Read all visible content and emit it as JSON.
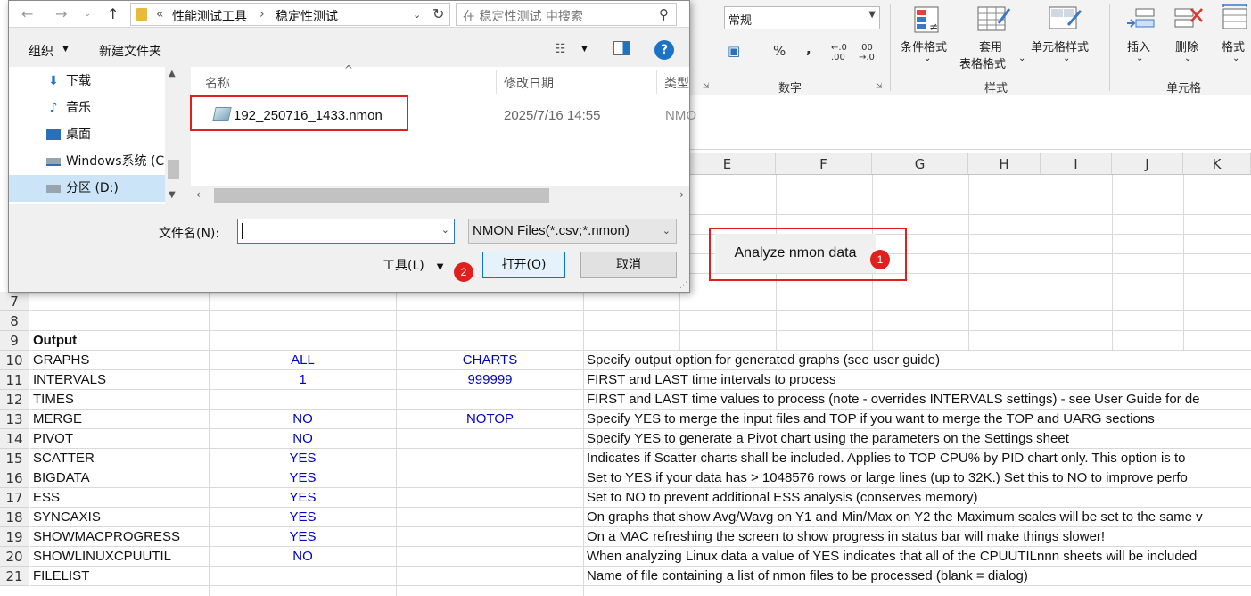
{
  "ribbon": {
    "number_format": "常规",
    "group_number": "数字",
    "group_styles": "样式",
    "group_cells": "单元格",
    "btn_conditional": "条件格式",
    "btn_table_line1": "套用",
    "btn_table_line2": "表格格式",
    "btn_cellstyle": "单元格样式",
    "btn_insert": "插入",
    "btn_delete": "删除",
    "btn_format": "格式",
    "percent": "%",
    "comma": ","
  },
  "dialog": {
    "path": [
      "性能测试工具",
      "稳定性测试"
    ],
    "search_placeholder": "在 稳定性测试 中搜索",
    "organize": "组织",
    "new_folder": "新建文件夹",
    "nav_items": [
      {
        "label": "下载",
        "icon": "download-icon"
      },
      {
        "label": "音乐",
        "icon": "music-icon"
      },
      {
        "label": "桌面",
        "icon": "desktop-icon"
      },
      {
        "label": "Windows系统 (C",
        "icon": "drive-icon"
      },
      {
        "label": "分区 (D:)",
        "icon": "drive-icon"
      }
    ],
    "columns": {
      "name": "名称",
      "date": "修改日期",
      "type": "类型"
    },
    "file": {
      "name": "192_250716_1433.nmon",
      "date": "2025/7/16 14:55",
      "type": "NMO"
    },
    "filename_label": "文件名(N):",
    "filename_value": "",
    "filter": "NMON Files(*.csv;*.nmon)",
    "tools": "工具(L)",
    "open": "打开(O)",
    "cancel": "取消"
  },
  "sheet": {
    "columns": [
      "E",
      "F",
      "G",
      "H",
      "I",
      "J",
      "K"
    ],
    "analyze_button": "Analyze nmon data",
    "badge1": "1",
    "badge2": "2",
    "rows": [
      {
        "n": "7",
        "a": "",
        "b": "",
        "c": "",
        "d": ""
      },
      {
        "n": "8",
        "a": "",
        "b": "",
        "c": "",
        "d": ""
      },
      {
        "n": "9",
        "a": "Output",
        "b": "",
        "c": "",
        "d": ""
      },
      {
        "n": "10",
        "a": "GRAPHS",
        "b": "ALL",
        "c": "CHARTS",
        "d": "Specify output option for generated graphs (see user guide)"
      },
      {
        "n": "11",
        "a": "INTERVALS",
        "b": "1",
        "c": "999999",
        "d": "FIRST and LAST time intervals to process"
      },
      {
        "n": "12",
        "a": "TIMES",
        "b": "",
        "c": "",
        "d": "FIRST and LAST time values to process (note - overrides INTERVALS settings) - see User Guide for de"
      },
      {
        "n": "13",
        "a": "MERGE",
        "b": "NO",
        "c": "NOTOP",
        "d": "Specify YES to merge the input files and TOP if you want to merge the TOP and UARG sections"
      },
      {
        "n": "14",
        "a": "PIVOT",
        "b": "NO",
        "c": "",
        "d": "Specify YES to generate a Pivot chart using the parameters on the Settings sheet"
      },
      {
        "n": "15",
        "a": "SCATTER",
        "b": "YES",
        "c": "",
        "d": "Indicates if Scatter charts shall be included.  Applies to TOP CPU% by PID chart only.  This option is to"
      },
      {
        "n": "16",
        "a": "BIGDATA",
        "b": "YES",
        "c": "",
        "d": "Set to YES if your data has > 1048576 rows or large lines (up to 32K.)  Set this to NO to improve perfo"
      },
      {
        "n": "17",
        "a": "ESS",
        "b": "YES",
        "c": "",
        "d": "Set to NO to prevent additional ESS analysis (conserves memory)"
      },
      {
        "n": "18",
        "a": "SYNCAXIS",
        "b": "YES",
        "c": "",
        "d": "On graphs that show Avg/Wavg on Y1 and Min/Max on Y2 the Maximum scales will be set to the same v"
      },
      {
        "n": "19",
        "a": "SHOWMACPROGRESS",
        "b": "YES",
        "c": "",
        "d": "On a MAC refreshing the screen to show progress in status bar will make things slower!"
      },
      {
        "n": "20",
        "a": "SHOWLINUXCPUUTIL",
        "b": "NO",
        "c": "",
        "d": "When analyzing Linux data a value of YES indicates that all of the CPUUTILnnn sheets will be included"
      },
      {
        "n": "21",
        "a": "FILELIST",
        "b": "",
        "c": "",
        "d": "Name of file containing a list of nmon files to be processed (blank = dialog)"
      }
    ]
  }
}
